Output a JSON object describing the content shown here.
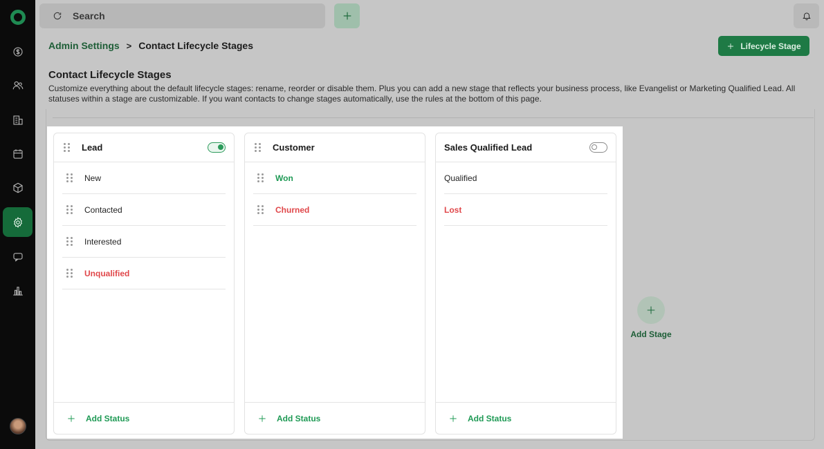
{
  "sidebar": {
    "items": [
      {
        "icon": "sales-icon"
      },
      {
        "icon": "contacts-icon"
      },
      {
        "icon": "companies-icon"
      },
      {
        "icon": "calendar-icon"
      },
      {
        "icon": "products-icon"
      },
      {
        "icon": "settings-icon",
        "active": true
      },
      {
        "icon": "conversations-icon"
      },
      {
        "icon": "reports-icon"
      }
    ]
  },
  "topbar": {
    "search_placeholder": "Search"
  },
  "breadcrumb": {
    "parent": "Admin Settings",
    "separator": ">",
    "current": "Contact Lifecycle Stages"
  },
  "header": {
    "add_button_label": "Lifecycle Stage",
    "title": "Contact Lifecycle Stages",
    "description": "Customize everything about the default lifecycle stages: rename, reorder or disable them. Plus you can add a new stage that reflects your business process, like Evangelist or Marketing Qualified Lead. All statuses within a stage are customizable. If you want contacts to change stages automatically, use the rules at the bottom of this page."
  },
  "stages": [
    {
      "name": "Lead",
      "enabled": true,
      "statuses": [
        {
          "label": "New",
          "tone": "plain"
        },
        {
          "label": "Contacted",
          "tone": "plain"
        },
        {
          "label": "Interested",
          "tone": "plain"
        },
        {
          "label": "Unqualified",
          "tone": "red"
        }
      ],
      "add_status_label": "Add Status"
    },
    {
      "name": "Customer",
      "statuses": [
        {
          "label": "Won",
          "tone": "green"
        },
        {
          "label": "Churned",
          "tone": "red"
        }
      ],
      "add_status_label": "Add Status"
    },
    {
      "name": "Sales Qualified Lead",
      "enabled": false,
      "statuses": [
        {
          "label": "Qualified",
          "tone": "plain"
        },
        {
          "label": "Lost",
          "tone": "red"
        }
      ],
      "add_status_label": "Add Status"
    }
  ],
  "add_stage_label": "Add Stage",
  "colors": {
    "brand_green": "#1e7a45",
    "status_green": "#1f9a55",
    "status_red": "#e0474a"
  }
}
